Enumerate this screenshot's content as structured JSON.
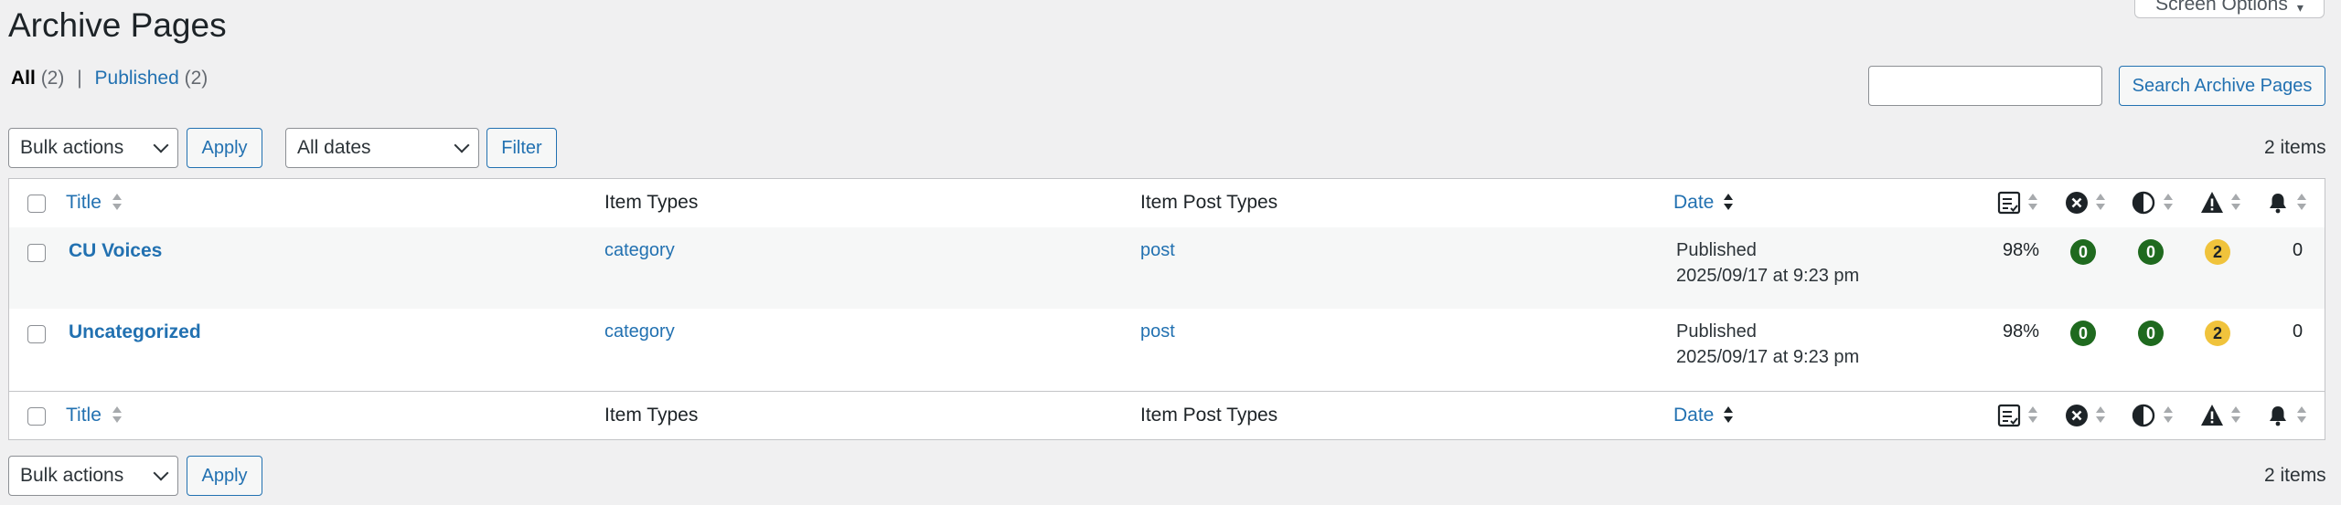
{
  "page": {
    "title": "Archive Pages",
    "screen_options": "Screen Options"
  },
  "views": {
    "all_label": "All",
    "all_count": "(2)",
    "sep": "|",
    "published_label": "Published",
    "published_count": "(2)"
  },
  "search": {
    "button": "Search Archive Pages",
    "value": ""
  },
  "top_nav": {
    "bulk_actions": "Bulk actions",
    "apply": "Apply",
    "dates": "All dates",
    "filter": "Filter",
    "count": "2 items"
  },
  "bottom_nav": {
    "bulk_actions": "Bulk actions",
    "apply": "Apply",
    "count": "2 items"
  },
  "columns": {
    "title": "Title",
    "item_types": "Item Types",
    "item_post_types": "Item Post Types",
    "date": "Date"
  },
  "icons": {
    "score": "checklist-icon",
    "errors": "error-icon",
    "contrast": "contrast-icon",
    "warnings": "warning-icon",
    "notices": "bell-icon"
  },
  "colors": {
    "accent": "#2271b1",
    "good": "#1f6a1f",
    "warn": "#f0c33c"
  },
  "rows": [
    {
      "title": "CU Voices",
      "item_types": "category",
      "item_post_types": "post",
      "status": "Published",
      "date": "2025/09/17 at 9:23 pm",
      "score": "98%",
      "errors": "0",
      "contrast": "0",
      "warnings": "2",
      "notices": "0"
    },
    {
      "title": "Uncategorized",
      "item_types": "category",
      "item_post_types": "post",
      "status": "Published",
      "date": "2025/09/17 at 9:23 pm",
      "score": "98%",
      "errors": "0",
      "contrast": "0",
      "warnings": "2",
      "notices": "0"
    }
  ]
}
